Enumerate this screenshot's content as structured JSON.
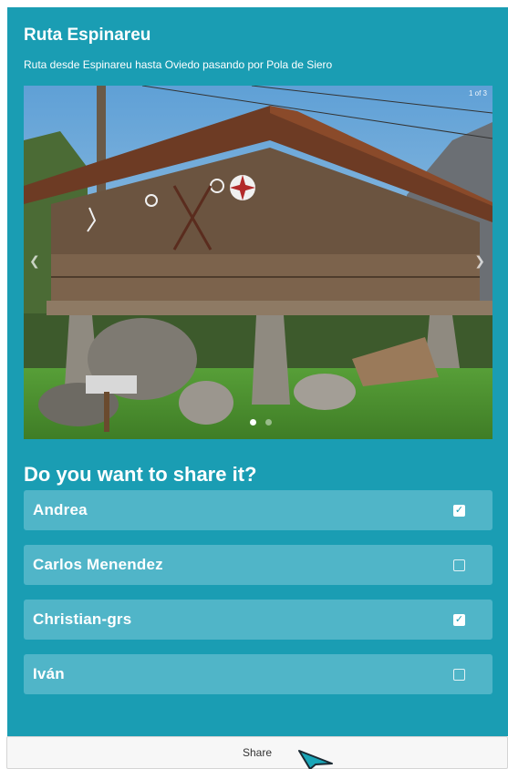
{
  "route": {
    "title": "Ruta Espinareu",
    "subtitle": "Ruta desde Espinareu hasta Oviedo pasando por Pola de Siero"
  },
  "carousel": {
    "counter": "1 of 3",
    "prev_icon": "chevron-left-icon",
    "next_icon": "chevron-right-icon",
    "slide_count": 2,
    "active_slide": 1
  },
  "share": {
    "heading": "Do you want to share it?",
    "users": [
      {
        "name": "Andrea",
        "checked": true
      },
      {
        "name": "Carlos Menendez",
        "checked": false
      },
      {
        "name": "Christian-grs",
        "checked": true
      },
      {
        "name": "Iván",
        "checked": false
      }
    ],
    "button_label": "Share"
  },
  "colors": {
    "card_bg": "#1a9db3",
    "row_bg": "#50b5c8",
    "text": "#ffffff"
  }
}
